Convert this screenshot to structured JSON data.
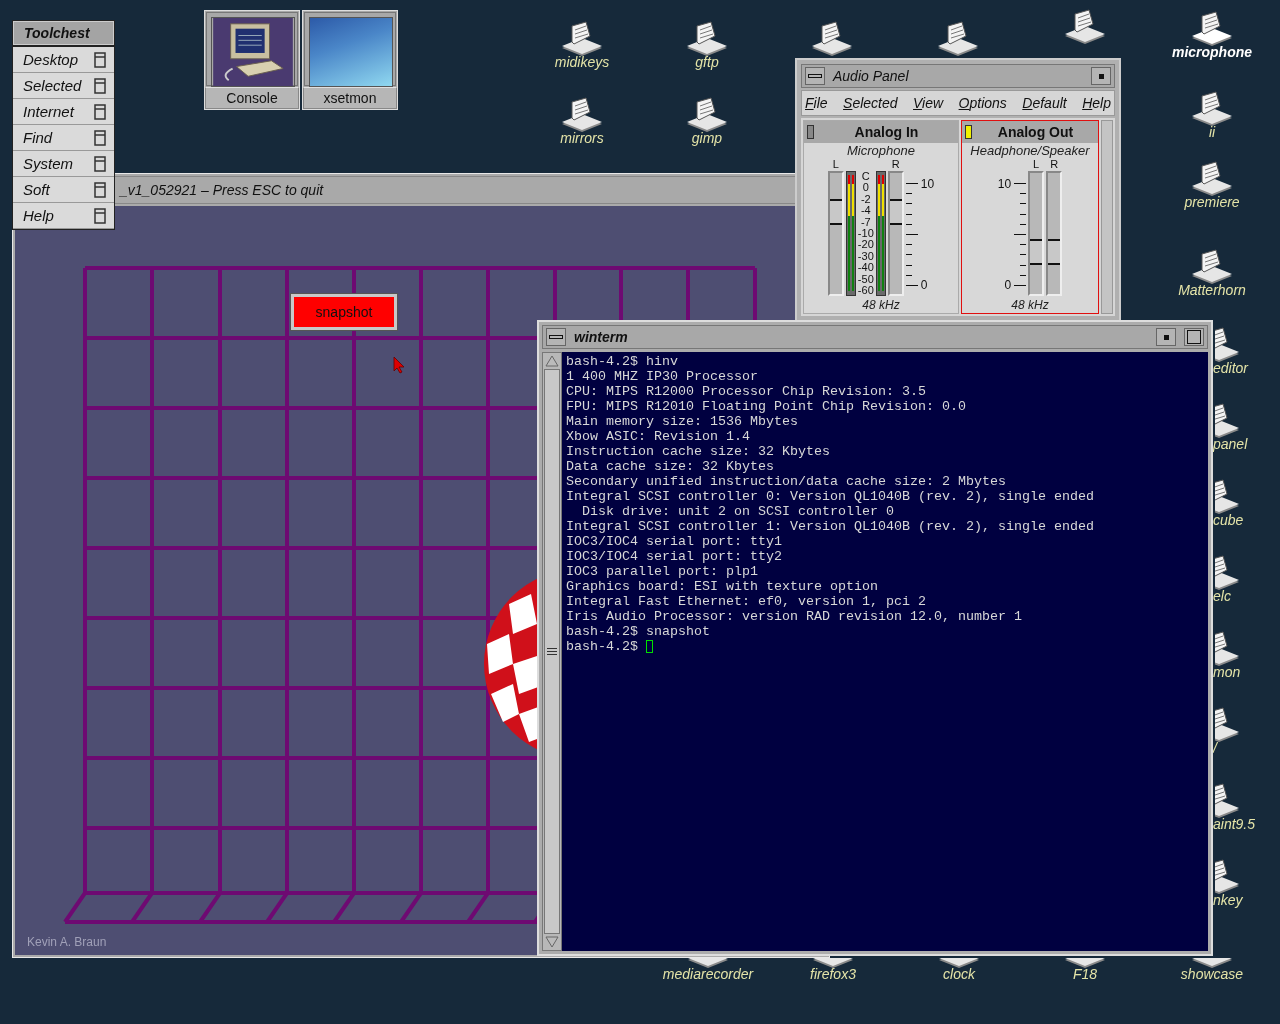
{
  "toolchest": {
    "title": "Toolchest",
    "items": [
      {
        "label": "Desktop"
      },
      {
        "label": "Selected"
      },
      {
        "label": "Internet"
      },
      {
        "label": "Find"
      },
      {
        "label": "System"
      },
      {
        "label": "Soft"
      },
      {
        "label": "Help"
      }
    ]
  },
  "launch_tiles": [
    {
      "label": "Console",
      "kind": "computer"
    },
    {
      "label": "xsetmon",
      "kind": "sky"
    }
  ],
  "desktop_icons": [
    {
      "label": "midikeys",
      "selected": false
    },
    {
      "label": "gftp",
      "selected": false
    },
    {
      "selected": false
    },
    {
      "selected": false
    },
    {
      "selected": false
    },
    {
      "label": "microphone",
      "selected": true
    },
    {
      "label": "mirrors",
      "selected": false
    },
    {
      "label": "gimp",
      "selected": false
    },
    {
      "label": "ii",
      "selected": false
    },
    {
      "label": "premiere",
      "selected": false
    },
    {
      "label": "Matterhorn",
      "selected": false
    },
    {
      "label": "editor",
      "selected": false
    },
    {
      "label": "panel",
      "selected": false
    },
    {
      "label": "cube",
      "selected": false
    },
    {
      "label": "elc",
      "selected": false
    },
    {
      "label": "mon",
      "selected": false
    },
    {
      "label": "/",
      "selected": false
    },
    {
      "label": "aint9.5",
      "selected": false
    },
    {
      "label": "nkey",
      "selected": false
    },
    {
      "label": "mediarecorder",
      "selected": false
    },
    {
      "label": "firefox3",
      "selected": false
    },
    {
      "label": "clock",
      "selected": false
    },
    {
      "label": "F18",
      "selected": false
    },
    {
      "label": "showcase",
      "selected": false
    }
  ],
  "demo_window": {
    "title": "_v1_052921 – Press ESC to quit",
    "button": "snapshot",
    "credit": "Kevin A. Braun"
  },
  "audio_panel": {
    "title": "Audio Panel",
    "menu": [
      "File",
      "Selected",
      "View",
      "Options",
      "Default",
      "Help"
    ],
    "channels": [
      {
        "kind": "input",
        "name": "Analog In",
        "source": "Microphone",
        "selected": false,
        "rate": "48 kHz",
        "sliders": [
          {
            "label": "L",
            "level": 0.68
          },
          {
            "label": "R",
            "level": 0.68
          }
        ],
        "meter_scale": [
          "C",
          "0",
          "-2",
          "-4",
          "-7",
          "-10",
          "-20",
          "-30",
          "-40",
          "-50",
          "-60"
        ],
        "ruler": [
          "10",
          "0"
        ]
      },
      {
        "kind": "output",
        "name": "Analog Out",
        "source": "Headphone/Speaker",
        "selected": true,
        "rate": "48 kHz",
        "sliders": [
          {
            "label": "L",
            "level": 0.35
          },
          {
            "label": "R",
            "level": 0.35
          }
        ],
        "ruler": [
          "10",
          "0"
        ]
      }
    ]
  },
  "terminal": {
    "title": "winterm",
    "lines": [
      "bash-4.2$ hinv",
      "1 400 MHZ IP30 Processor",
      "CPU: MIPS R12000 Processor Chip Revision: 3.5",
      "FPU: MIPS R12010 Floating Point Chip Revision: 0.0",
      "Main memory size: 1536 Mbytes",
      "Xbow ASIC: Revision 1.4",
      "Instruction cache size: 32 Kbytes",
      "Data cache size: 32 Kbytes",
      "Secondary unified instruction/data cache size: 2 Mbytes",
      "Integral SCSI controller 0: Version QL1040B (rev. 2), single ended",
      "  Disk drive: unit 2 on SCSI controller 0",
      "Integral SCSI controller 1: Version QL1040B (rev. 2), single ended",
      "IOC3/IOC4 serial port: tty1",
      "IOC3/IOC4 serial port: tty2",
      "IOC3 parallel port: plp1",
      "Graphics board: ESI with texture option",
      "Integral Fast Ethernet: ef0, version 1, pci 2",
      "Iris Audio Processor: version RAD revision 12.0, number 1",
      "bash-4.2$ snapshot"
    ],
    "prompt": "bash-4.2$"
  }
}
